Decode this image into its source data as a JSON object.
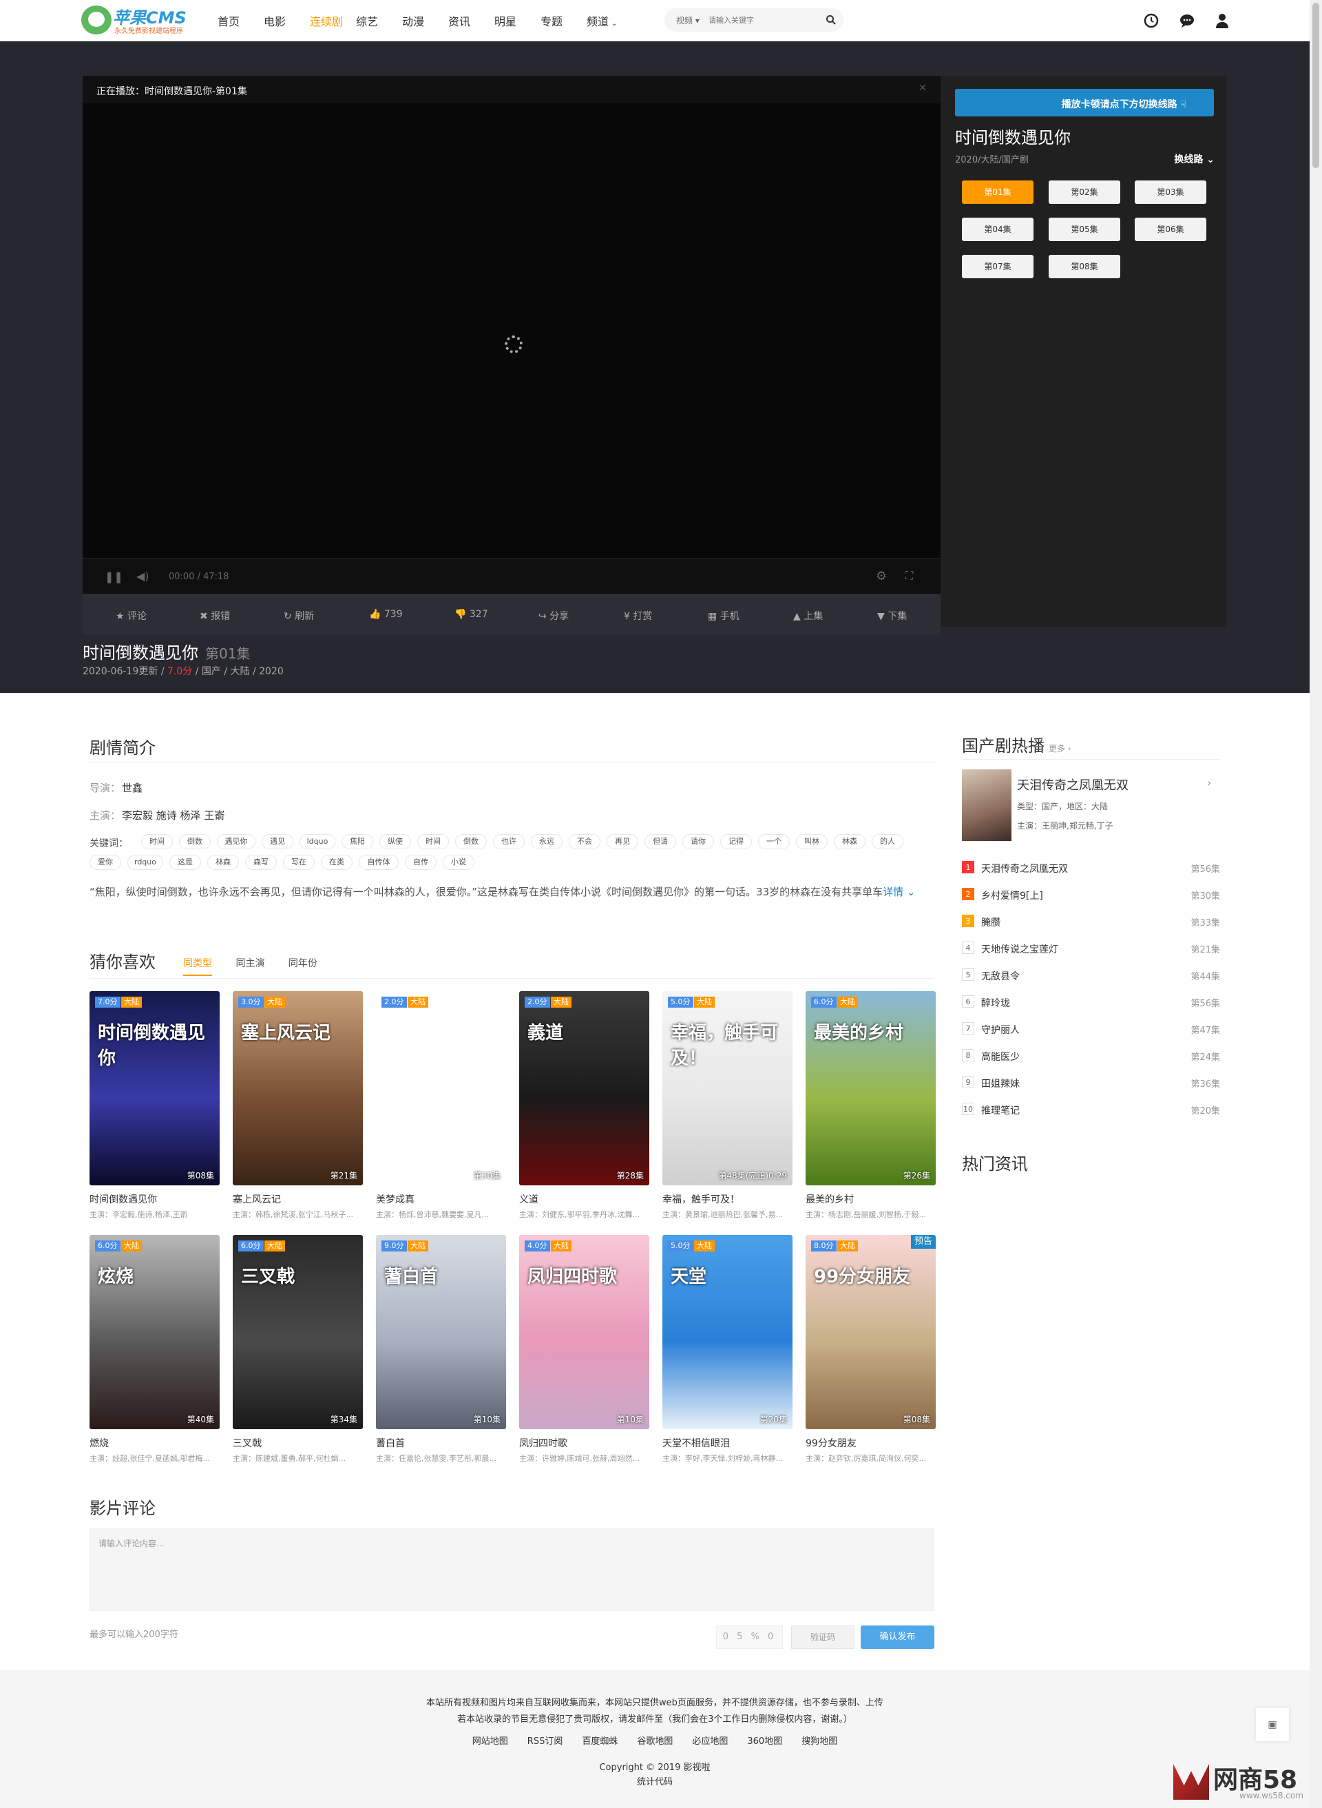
{
  "header": {
    "logo_text": "苹果CMS",
    "logo_slogan": "永久免费影视建站程序",
    "nav": [
      "首页",
      "电影",
      "连续剧",
      "综艺",
      "动漫",
      "资讯",
      "明星",
      "专题",
      "频道"
    ],
    "nav_active_index": 2,
    "search_select": "视频",
    "search_placeholder": "请输入关键字"
  },
  "player": {
    "now_playing": "正在播放：时间倒数遇见你-第01集",
    "time": "00:00 / 47:18",
    "actions": [
      "评论",
      "报错",
      "刷新",
      "739",
      "327",
      "分享",
      "打赏",
      "手机",
      "上集",
      "下集"
    ]
  },
  "side": {
    "switch_banner": "播放卡顿请点下方切换线路",
    "title": "时间倒数遇见你",
    "meta": "2020/大陆/国产剧",
    "switch_label": "换线路",
    "episodes": [
      "第01集",
      "第02集",
      "第03集",
      "第04集",
      "第05集",
      "第06集",
      "第07集",
      "第08集"
    ]
  },
  "info": {
    "title": "时间倒数遇见你",
    "episode": "第01集",
    "updated": "2020-06-19更新",
    "score": "7.0分",
    "tags": "国产 / 大陆 / 2020"
  },
  "synopsis": {
    "heading": "剧情简介",
    "director_label": "导演：",
    "director": "世鑫",
    "actors_label": "主演：",
    "actors": "李宏毅  施诗  杨泽  王嵛",
    "keywords_label": "关键词：",
    "keywords": [
      "时间",
      "倒数",
      "遇见你",
      "遇见",
      "ldquo",
      "焦阳",
      "纵使",
      "时间",
      "倒数",
      "也许",
      "永远",
      "不会",
      "再见",
      "但请",
      "请你",
      "记得",
      "一个",
      "叫林",
      "林森",
      "的人",
      "爱你",
      "rdquo",
      "这是",
      "林森",
      "森写",
      "写在",
      "在类",
      "自传体",
      "自传",
      "小说"
    ],
    "text": "“焦阳，纵使时间倒数，也许永远不会再见，但请你记得有一个叫林森的人，很爱你。”这是林森写在类自传体小说《时间倒数遇见你》的第一句话。33岁的林森在没有共享单车",
    "more": "详情"
  },
  "guess": {
    "heading": "猜你喜欢",
    "tabs": [
      "同类型",
      "同主演",
      "同年份"
    ],
    "cards": [
      {
        "title": "时间倒数遇见你",
        "score": "7.0分",
        "area": "大陆",
        "ep": "第08集",
        "actors": "主演：李宏毅,施诗,杨泽,王嵛",
        "poster": "时间倒数遇见你",
        "colors": [
          "#141a4a",
          "#3a3aa8",
          "#0a0a2a"
        ]
      },
      {
        "title": "塞上风云记",
        "score": "3.0分",
        "area": "大陆",
        "ep": "第21集",
        "actors": "主演：韩栋,徐梵溪,张宁江,马秋子...",
        "poster": "塞上风云记",
        "colors": [
          "#c8a07a",
          "#7a5034",
          "#3a2414"
        ]
      },
      {
        "title": "美梦成真",
        "score": "2.0分",
        "area": "大陆",
        "ep": "第30集",
        "actors": "主演：杨烁,曾沛慈,魏要要,夏凡...",
        "poster": "",
        "colors": [
          "#ffffff",
          "#ffffff",
          "#ffffff"
        ]
      },
      {
        "title": "义道",
        "score": "2.0分",
        "area": "大陆",
        "ep": "第28集",
        "actors": "主演：刘健东,邬平羽,季丹冰,沈舞...",
        "poster": "義道",
        "colors": [
          "#3a3a3a",
          "#1a1a1a",
          "#6a0a0a"
        ]
      },
      {
        "title": "幸福，触手可及！",
        "score": "5.0分",
        "area": "大陆",
        "ep": "第48集(完正)0:29",
        "actors": "主演：黄景瑜,迪丽热巴,张馨予,易...",
        "poster": "幸福，触手可及！",
        "colors": [
          "#f5f5f5",
          "#e8e8e8",
          "#cfcfcf"
        ]
      },
      {
        "title": "最美的乡村",
        "score": "6.0分",
        "area": "大陆",
        "ep": "第26集",
        "actors": "主演：杨志刚,岳丽媛,刘智扬,于毅...",
        "poster": "最美的乡村",
        "colors": [
          "#8ab8d8",
          "#9ab848",
          "#4a7a18"
        ]
      },
      {
        "title": "燃烧",
        "score": "6.0分",
        "area": "大陆",
        "ep": "第40集",
        "actors": "主演：经超,张佳宁,夏菡嫣,邬君梅...",
        "poster": "炫烧",
        "colors": [
          "#b8b8b8",
          "#5a5a5a",
          "#2a1a1a"
        ]
      },
      {
        "title": "三叉戟",
        "score": "6.0分",
        "area": "大陆",
        "ep": "第34集",
        "actors": "主演：陈建斌,董勇,郝平,何杜娟...",
        "poster": "三叉戟",
        "colors": [
          "#2a2a2a",
          "#4a4a4a",
          "#1a1a1a"
        ]
      },
      {
        "title": "蓍白首",
        "score": "9.0分",
        "area": "大陆",
        "ep": "第10集",
        "actors": "主演：任嘉伦,张慧雯,李艺彤,郭晨...",
        "poster": "蓍白首",
        "colors": [
          "#d8dce4",
          "#a8b0c0",
          "#5a6070"
        ]
      },
      {
        "title": "凤归四时歌",
        "score": "4.0分",
        "area": "大陆",
        "ep": "第10集",
        "actors": "主演：许雅婷,陈靖可,张赫,周翊然...",
        "poster": "凤归四时歌",
        "colors": [
          "#f8c8d8",
          "#e898b8",
          "#c8a8c8"
        ]
      },
      {
        "title": "天堂不相信眼泪",
        "score": "5.0分",
        "area": "大陆",
        "ep": "第20集",
        "actors": "主演：李好,李天怿,刘梓娇,蒋林静...",
        "poster": "天堂",
        "colors": [
          "#4aa0e8",
          "#2a80d8",
          "#e8f0f8"
        ]
      },
      {
        "title": "99分女朋友",
        "score": "8.0分",
        "area": "大陆",
        "ep": "第08集",
        "actors": "主演：赵弈钦,厉嘉琪,简洵仪,何奕...",
        "poster": "99分女朋友",
        "colors": [
          "#f8d8d8",
          "#c8b088",
          "#8a6a48"
        ],
        "badge": "预告"
      }
    ]
  },
  "comment": {
    "heading": "影片评论",
    "placeholder": "请输入评论内容...",
    "hint": "最多可以输入200字符",
    "captcha": "0 5 % 0",
    "verify": "验证码",
    "submit": "确认发布"
  },
  "hot": {
    "heading": "国产剧热播",
    "more": "更多",
    "featured": {
      "title": "天泪传奇之凤凰无双",
      "meta": "类型：国产，地区：大陆",
      "actors": "主演：王丽坤,郑元畅,丁子"
    },
    "list": [
      {
        "n": "1",
        "title": "天泪传奇之凤凰无双",
        "ep": "第56集"
      },
      {
        "n": "2",
        "title": "乡村爱情9[上]",
        "ep": "第30集"
      },
      {
        "n": "3",
        "title": "腌臜",
        "ep": "第33集"
      },
      {
        "n": "4",
        "title": "天地传说之宝莲灯",
        "ep": "第21集"
      },
      {
        "n": "5",
        "title": "无敌县令",
        "ep": "第44集"
      },
      {
        "n": "6",
        "title": "醉玲珑",
        "ep": "第56集"
      },
      {
        "n": "7",
        "title": "守护丽人",
        "ep": "第47集"
      },
      {
        "n": "8",
        "title": "高能医少",
        "ep": "第24集"
      },
      {
        "n": "9",
        "title": "田姐辣妹",
        "ep": "第36集"
      },
      {
        "n": "10",
        "title": "推理笔记",
        "ep": "第20集"
      }
    ],
    "news_heading": "热门资讯"
  },
  "footer": {
    "line1": "本站所有视频和图片均来自互联网收集而来，本网站只提供web页面服务，并不提供资源存储，也不参与录制、上传",
    "line2": "若本站收录的节目无意侵犯了贵司版权，请发邮件至（我们会在3个工作日内删除侵权内容，谢谢。）",
    "links": [
      "网站地图",
      "RSS订阅",
      "百度蜘蛛",
      "谷歌地图",
      "必应地图",
      "360地图",
      "搜狗地图"
    ],
    "copyright": "Copyright © 2019 影视啦",
    "stats": "统计代码"
  },
  "watermark": {
    "brand": "网商58",
    "url": "www.ws58.com"
  }
}
